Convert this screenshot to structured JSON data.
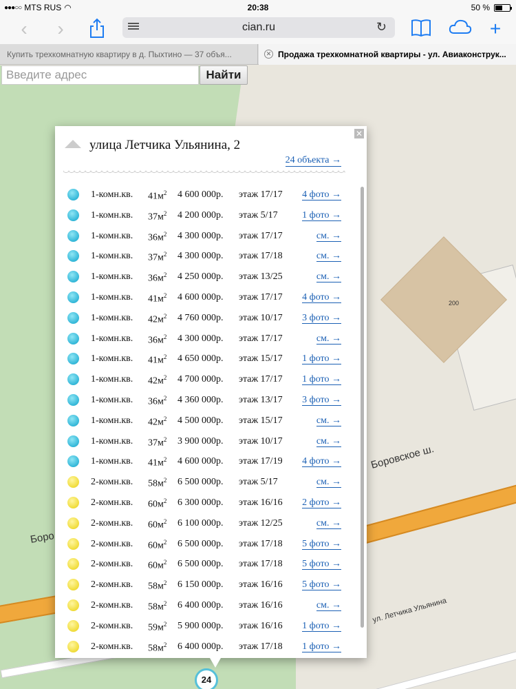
{
  "status": {
    "carrier": "MTS RUS",
    "time": "20:38",
    "battery": "50 %"
  },
  "browser": {
    "domain": "cian.ru",
    "tabs": [
      {
        "label": "Купить трехкомнатную квартиру в д. Пыхтино — 37 объя..."
      },
      {
        "label": "Продажа трехкомнатной квартиры - ул. Авиаконструк..."
      }
    ]
  },
  "search": {
    "placeholder": "Введите адрес",
    "button": "Найти"
  },
  "map": {
    "building_number": "200",
    "road_label": "Боровское ш.",
    "road_label_short": "Боро",
    "street_label": "ул. Летчика Ульянина",
    "marker_count": "24"
  },
  "popup": {
    "title": "улица Летчика Ульянина, 2",
    "objects_link": "24 объекта →",
    "listings": [
      {
        "type": "blue",
        "rooms": "1-комн.кв.",
        "area": "41",
        "price": "4 600 000р.",
        "floor": "этаж 17/17",
        "link": "4 фото →"
      },
      {
        "type": "blue",
        "rooms": "1-комн.кв.",
        "area": "37",
        "price": "4 200 000р.",
        "floor": "этаж 5/17",
        "link": "1 фото →"
      },
      {
        "type": "blue",
        "rooms": "1-комн.кв.",
        "area": "36",
        "price": "4 300 000р.",
        "floor": "этаж 17/17",
        "link": "см. →"
      },
      {
        "type": "blue",
        "rooms": "1-комн.кв.",
        "area": "37",
        "price": "4 300 000р.",
        "floor": "этаж 17/18",
        "link": "см. →"
      },
      {
        "type": "blue",
        "rooms": "1-комн.кв.",
        "area": "36",
        "price": "4 250 000р.",
        "floor": "этаж 13/25",
        "link": "см. →"
      },
      {
        "type": "blue",
        "rooms": "1-комн.кв.",
        "area": "41",
        "price": "4 600 000р.",
        "floor": "этаж 17/17",
        "link": "4 фото →"
      },
      {
        "type": "blue",
        "rooms": "1-комн.кв.",
        "area": "42",
        "price": "4 760 000р.",
        "floor": "этаж 10/17",
        "link": "3 фото →"
      },
      {
        "type": "blue",
        "rooms": "1-комн.кв.",
        "area": "36",
        "price": "4 300 000р.",
        "floor": "этаж 17/17",
        "link": "см. →"
      },
      {
        "type": "blue",
        "rooms": "1-комн.кв.",
        "area": "41",
        "price": "4 650 000р.",
        "floor": "этаж 15/17",
        "link": "1 фото →"
      },
      {
        "type": "blue",
        "rooms": "1-комн.кв.",
        "area": "42",
        "price": "4 700 000р.",
        "floor": "этаж 17/17",
        "link": "1 фото →"
      },
      {
        "type": "blue",
        "rooms": "1-комн.кв.",
        "area": "36",
        "price": "4 360 000р.",
        "floor": "этаж 13/17",
        "link": "3 фото →"
      },
      {
        "type": "blue",
        "rooms": "1-комн.кв.",
        "area": "42",
        "price": "4 500 000р.",
        "floor": "этаж 15/17",
        "link": "см. →"
      },
      {
        "type": "blue",
        "rooms": "1-комн.кв.",
        "area": "37",
        "price": "3 900 000р.",
        "floor": "этаж 10/17",
        "link": "см. →"
      },
      {
        "type": "blue",
        "rooms": "1-комн.кв.",
        "area": "41",
        "price": "4 600 000р.",
        "floor": "этаж 17/19",
        "link": "4 фото →"
      },
      {
        "type": "yellow",
        "rooms": "2-комн.кв.",
        "area": "58",
        "price": "6 500 000р.",
        "floor": "этаж 5/17",
        "link": "см. →"
      },
      {
        "type": "yellow",
        "rooms": "2-комн.кв.",
        "area": "60",
        "price": "6 300 000р.",
        "floor": "этаж 16/16",
        "link": "2 фото →"
      },
      {
        "type": "yellow",
        "rooms": "2-комн.кв.",
        "area": "60",
        "price": "6 100 000р.",
        "floor": "этаж 12/25",
        "link": "см. →"
      },
      {
        "type": "yellow",
        "rooms": "2-комн.кв.",
        "area": "60",
        "price": "6 500 000р.",
        "floor": "этаж 17/18",
        "link": "5 фото →"
      },
      {
        "type": "yellow",
        "rooms": "2-комн.кв.",
        "area": "60",
        "price": "6 500 000р.",
        "floor": "этаж 17/18",
        "link": "5 фото →"
      },
      {
        "type": "yellow",
        "rooms": "2-комн.кв.",
        "area": "58",
        "price": "6 150 000р.",
        "floor": "этаж 16/16",
        "link": "5 фото →"
      },
      {
        "type": "yellow",
        "rooms": "2-комн.кв.",
        "area": "58",
        "price": "6 400 000р.",
        "floor": "этаж 16/16",
        "link": "см. →"
      },
      {
        "type": "yellow",
        "rooms": "2-комн.кв.",
        "area": "59",
        "price": "5 900 000р.",
        "floor": "этаж 16/16",
        "link": "1 фото →"
      },
      {
        "type": "yellow",
        "rooms": "2-комн.кв.",
        "area": "58",
        "price": "6 400 000р.",
        "floor": "этаж 17/18",
        "link": "1 фото →"
      }
    ]
  },
  "icons": [
    "back-icon",
    "forward-icon",
    "share-icon",
    "reader-icon",
    "reload-icon",
    "bookmarks-icon",
    "cloud-icon",
    "new-tab-icon",
    "close-icon",
    "house-icon",
    "wifi-icon"
  ],
  "colors": {
    "link": "#1a5fb4",
    "accent": "#1d7cf2",
    "one_room_dot": "#33b7d8",
    "two_room_dot": "#f0dc3a"
  }
}
